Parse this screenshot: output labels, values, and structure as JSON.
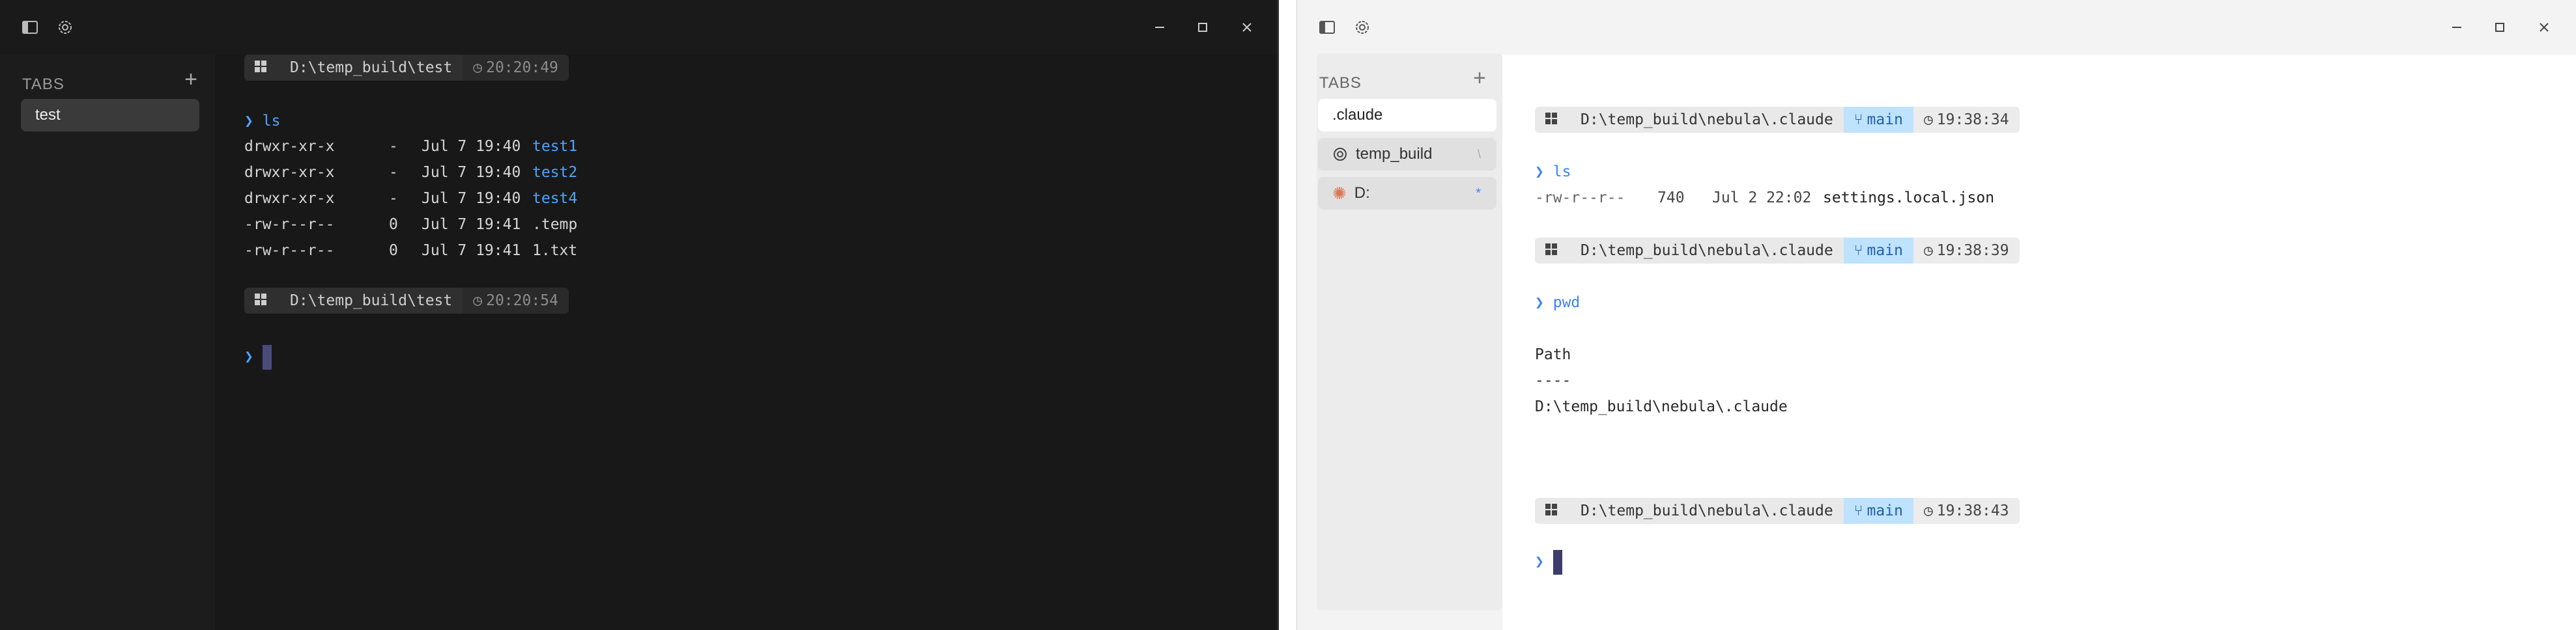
{
  "dark": {
    "sidebar": {
      "tabs_label": "TABS",
      "add_icon": "plus-icon",
      "tabs": [
        {
          "label": "test"
        }
      ]
    },
    "prompts": [
      {
        "path": "D:\\temp_build\\test",
        "time": "20:20:49"
      },
      {
        "path": "D:\\temp_build\\test",
        "time": "20:20:54"
      }
    ],
    "command": "ls",
    "listing": [
      {
        "mode": "drwxr-xr-x",
        "size": "-",
        "date": "Jul 7 19:40",
        "name": "test1"
      },
      {
        "mode": "drwxr-xr-x",
        "size": "-",
        "date": "Jul 7 19:40",
        "name": "test2"
      },
      {
        "mode": "drwxr-xr-x",
        "size": "-",
        "date": "Jul 7 19:40",
        "name": "test4"
      },
      {
        "mode": "-rw-r--r--",
        "size": "0",
        "date": "Jul 7 19:41",
        "name": ".temp"
      },
      {
        "mode": "-rw-r--r--",
        "size": "0",
        "date": "Jul 7 19:41",
        "name": "1.txt"
      }
    ],
    "prompt_symbol": "❯"
  },
  "light": {
    "sidebar": {
      "tabs_label": "TABS",
      "tabs": [
        {
          "label": ".claude",
          "icon": ""
        },
        {
          "label": "temp_build",
          "icon": "openai-icon",
          "badge": "\\"
        },
        {
          "label": "D:",
          "icon": "claude-sparkle-icon",
          "badge": "*"
        }
      ]
    },
    "prompts": [
      {
        "path": "D:\\temp_build\\nebula\\.claude",
        "branch": "main",
        "time": "19:38:34"
      },
      {
        "path": "D:\\temp_build\\nebula\\.claude",
        "branch": "main",
        "time": "19:38:39"
      },
      {
        "path": "D:\\temp_build\\nebula\\.claude",
        "branch": "main",
        "time": "19:38:43"
      }
    ],
    "cmd1": "ls",
    "listing": [
      {
        "mode": "-rw-r--r--",
        "size": "740",
        "date": "Jul 2 22:02",
        "name": "settings.local.json"
      }
    ],
    "cmd2": "pwd",
    "pwd_out": {
      "header": "Path",
      "rule": "----",
      "value": "D:\\temp_build\\nebula\\.claude"
    },
    "prompt_symbol": "❯"
  },
  "colors": {
    "accent_blue": "#4fa3ff",
    "branch_bg": "#bfe3ff",
    "caret": "#4a4a7a"
  }
}
